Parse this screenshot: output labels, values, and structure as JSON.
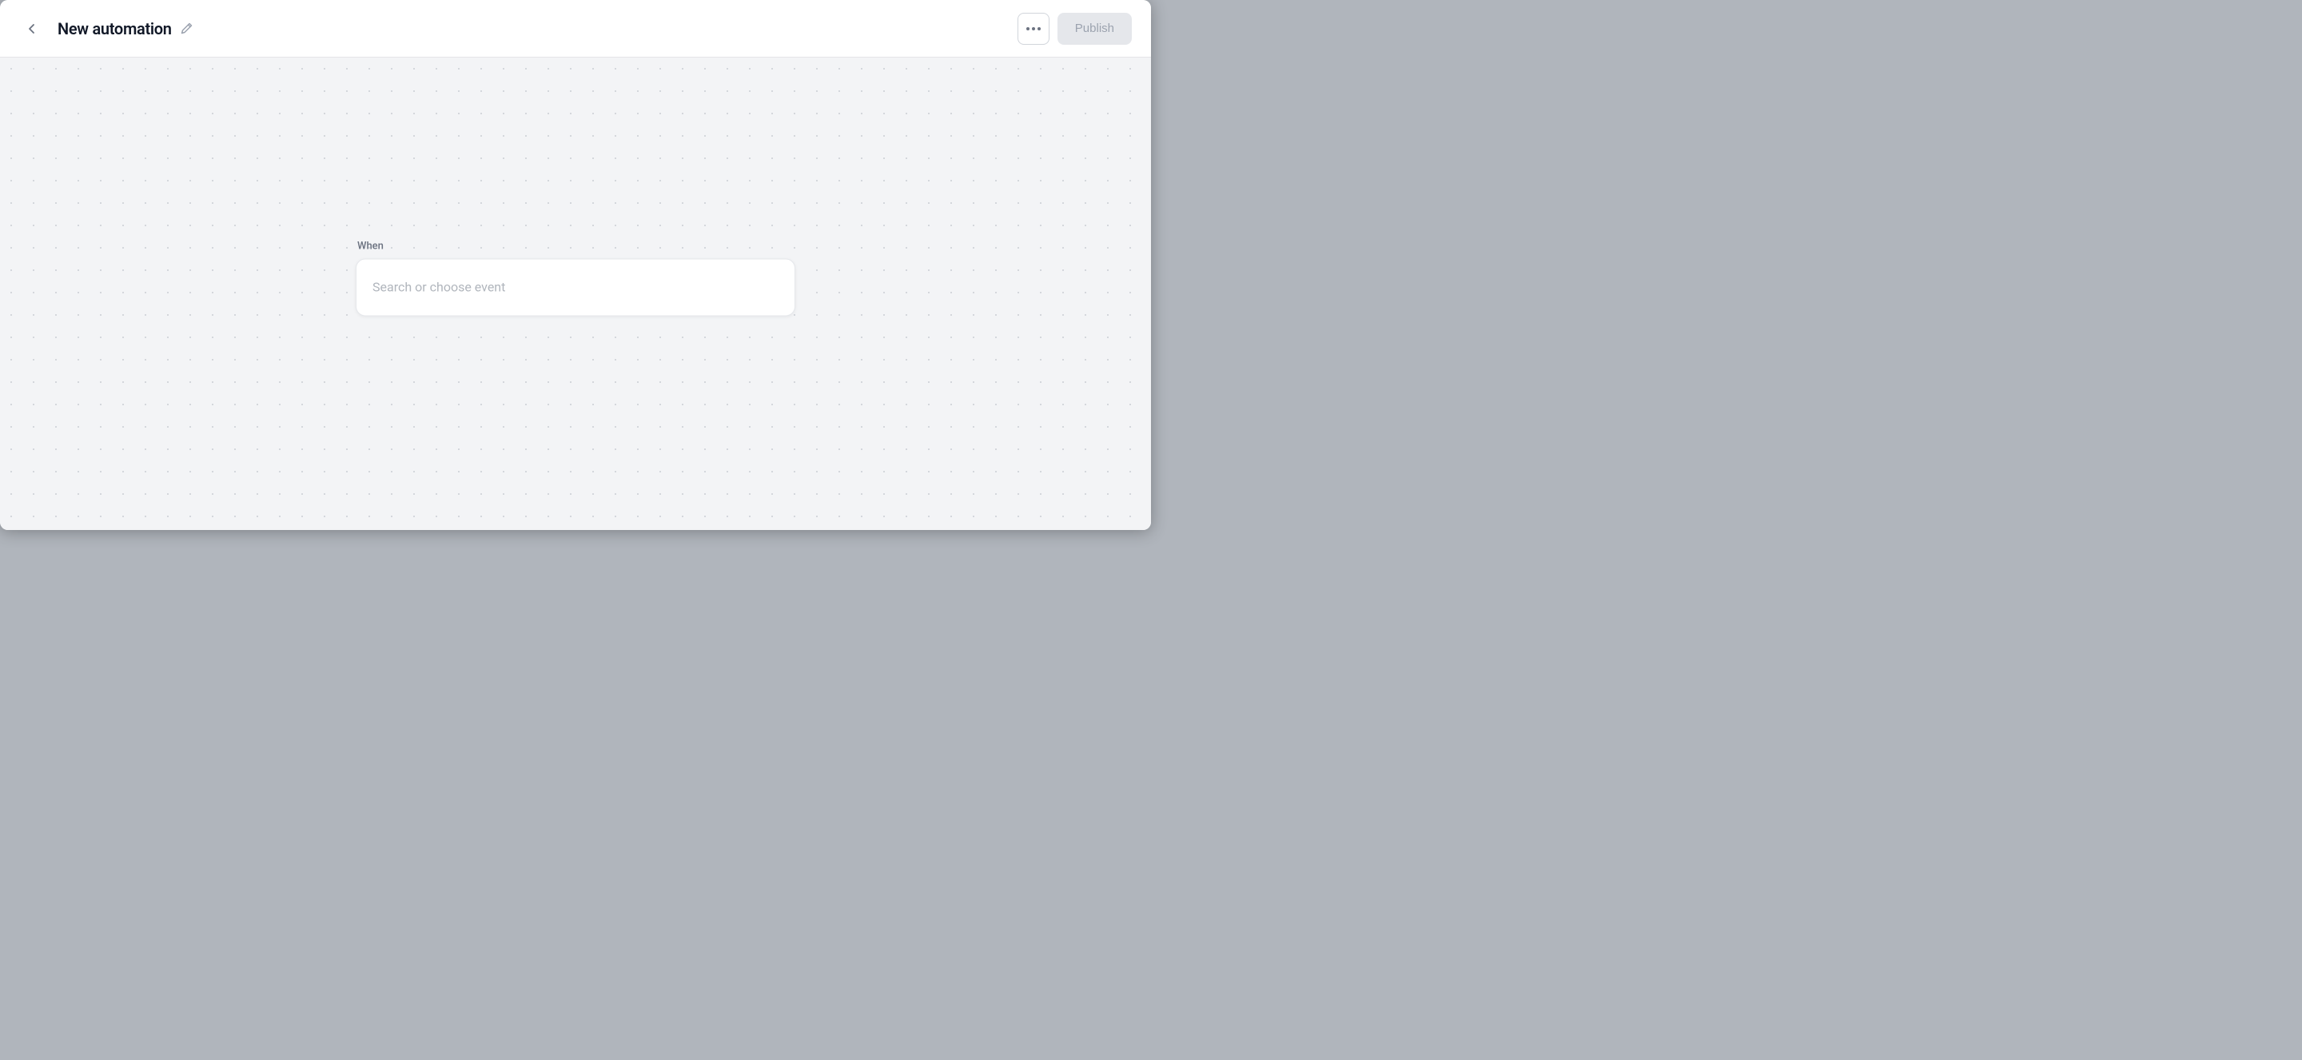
{
  "header": {
    "back_label": "←",
    "title": "New automation",
    "edit_icon_label": "✏",
    "more_label": "···",
    "publish_label": "Publish"
  },
  "canvas": {
    "when_label": "When",
    "search_placeholder": "Search or choose event"
  },
  "colors": {
    "publish_bg": "#e5e7eb",
    "publish_text": "#9ca3af",
    "back_color": "#6b7280",
    "title_color": "#111827",
    "placeholder_color": "#b0b5bc"
  }
}
